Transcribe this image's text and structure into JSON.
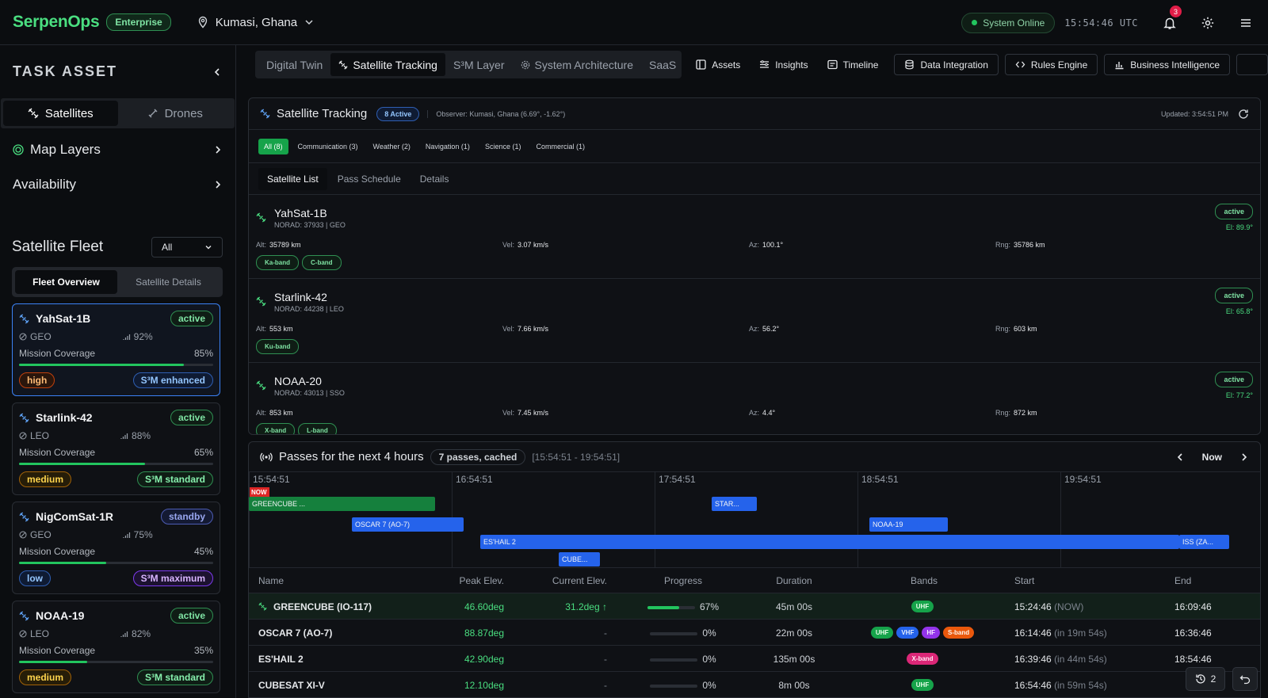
{
  "app": {
    "name": "SerpenOps",
    "tier": "Enterprise",
    "location": "Kumasi, Ghana",
    "status": "System Online",
    "clock": "15:54:46 UTC",
    "notifications": "3"
  },
  "sidebar": {
    "title": "TASK ASSET",
    "tabs": [
      "Satellites",
      "Drones"
    ],
    "sections": [
      "Map Layers",
      "Availability"
    ],
    "fleet_title": "Satellite Fleet",
    "filter_value": "All",
    "fleet_tabs": [
      "Fleet Overview",
      "Satellite Details"
    ],
    "coverage_label": "Mission Coverage",
    "cards": [
      {
        "name": "YahSat-1B",
        "status": "active",
        "orbit": "GEO",
        "signal": "92%",
        "coverage": "85%",
        "coverage_value": 85,
        "priority": "high",
        "s3m": "S³M enhanced"
      },
      {
        "name": "Starlink-42",
        "status": "active",
        "orbit": "LEO",
        "signal": "88%",
        "coverage": "65%",
        "coverage_value": 65,
        "priority": "medium",
        "s3m": "S³M standard"
      },
      {
        "name": "NigComSat-1R",
        "status": "standby",
        "orbit": "GEO",
        "signal": "75%",
        "coverage": "45%",
        "coverage_value": 45,
        "priority": "low",
        "s3m": "S³M maximum"
      },
      {
        "name": "NOAA-19",
        "status": "active",
        "orbit": "LEO",
        "signal": "82%",
        "coverage": "35%",
        "coverage_value": 35,
        "priority": "medium",
        "s3m": "S³M standard"
      }
    ]
  },
  "nav": {
    "tabs": [
      "Digital Twin",
      "Satellite Tracking",
      "S³M Layer",
      "System Architecture",
      "SaaS"
    ],
    "buttons": [
      "Assets",
      "Insights",
      "Timeline"
    ],
    "boxed": [
      "Data Integration",
      "Rules Engine",
      "Business Intelligence"
    ]
  },
  "tracking": {
    "title": "Satellite Tracking",
    "active": "8 Active",
    "observer": "Observer: Kumasi, Ghana (6.69°, -1.62°)",
    "updated": "Updated: 3:54:51 PM",
    "filters": [
      "All (8)",
      "Communication (3)",
      "Weather (2)",
      "Navigation (1)",
      "Science (1)",
      "Commercial (1)"
    ],
    "subtabs": [
      "Satellite List",
      "Pass Schedule",
      "Details"
    ],
    "labels": {
      "alt": "Alt:",
      "vel": "Vel:",
      "az": "Az:",
      "rng": "Rng:"
    },
    "satellites": [
      {
        "name": "YahSat-1B",
        "norad": "NORAD: 37933 | GEO",
        "status": "active",
        "el": "El: 89.9°",
        "alt": "35789 km",
        "vel": "3.07 km/s",
        "az": "100.1°",
        "rng": "35786 km",
        "bands": [
          "Ka-band",
          "C-band"
        ]
      },
      {
        "name": "Starlink-42",
        "norad": "NORAD: 44238 | LEO",
        "status": "active",
        "el": "El: 65.8°",
        "alt": "553 km",
        "vel": "7.66 km/s",
        "az": "56.2°",
        "rng": "603 km",
        "bands": [
          "Ku-band"
        ]
      },
      {
        "name": "NOAA-20",
        "norad": "NORAD: 43013 | SSO",
        "status": "active",
        "el": "El: 77.2°",
        "alt": "853 km",
        "vel": "7.45 km/s",
        "az": "4.4°",
        "rng": "872 km",
        "bands": [
          "X-band",
          "L-band"
        ]
      }
    ]
  },
  "passes": {
    "title": "Passes for the next 4 hours",
    "cached": "7 passes, cached",
    "range": "[15:54:51 - 19:54:51]",
    "now_btn": "Now",
    "now_marker": "NOW",
    "ticks": [
      "15:54:51",
      "16:54:51",
      "17:54:51",
      "18:54:51",
      "19:54:51"
    ],
    "timeline": [
      {
        "label": "GREENCUBE ...",
        "color": "#15803d",
        "start_min": 0,
        "end_min": 45,
        "lane": 0
      },
      {
        "label": "STAR...",
        "color": "#2563eb",
        "start_min": 112,
        "end_min": 123,
        "lane": 0
      },
      {
        "label": "OSCAR 7 (AO-7)",
        "color": "#2563eb",
        "start_min": 25,
        "end_min": 52,
        "lane": 1
      },
      {
        "label": "NOAA-19",
        "color": "#2563eb",
        "start_min": 150,
        "end_min": 169,
        "lane": 1
      },
      {
        "label": "ES'HAIL 2",
        "color": "#2563eb",
        "start_min": 56,
        "end_min": 225,
        "lane": 2
      },
      {
        "label": "ISS (ZA...",
        "color": "#2563eb",
        "start_min": 225,
        "end_min": 237,
        "lane": 2
      },
      {
        "label": "CUBE...",
        "color": "#2563eb",
        "start_min": 75,
        "end_min": 85,
        "lane": 3
      }
    ],
    "columns": [
      "Name",
      "Peak Elev.",
      "Current Elev.",
      "Progress",
      "Duration",
      "Bands",
      "Start",
      "End"
    ],
    "rows": [
      {
        "name": "GREENCUBE (IO-117)",
        "peak": "46.60deg",
        "current": "31.2deg ↑",
        "progress": "67%",
        "progress_value": 67,
        "duration": "45m 00s",
        "bands": [
          "UHF"
        ],
        "start": "15:24:46",
        "start_rel": "(NOW)",
        "end": "16:09:46"
      },
      {
        "name": "OSCAR 7 (AO-7)",
        "peak": "88.87deg",
        "current": "-",
        "progress": "0%",
        "progress_value": 0,
        "duration": "22m 00s",
        "bands": [
          "UHF",
          "VHF",
          "HF",
          "S-band"
        ],
        "start": "16:14:46",
        "start_rel": "(in 19m 54s)",
        "end": "16:36:46"
      },
      {
        "name": "ES'HAIL 2",
        "peak": "42.90deg",
        "current": "-",
        "progress": "0%",
        "progress_value": 0,
        "duration": "135m 00s",
        "bands": [
          "X-band"
        ],
        "start": "16:39:46",
        "start_rel": "(in 44m 54s)",
        "end": "18:54:46"
      },
      {
        "name": "CUBESAT XI-V",
        "peak": "12.10deg",
        "current": "-",
        "progress": "0%",
        "progress_value": 0,
        "duration": "8m 00s",
        "bands": [
          "UHF"
        ],
        "start": "16:54:46",
        "start_rel": "(in 59m 54s)",
        "end": ""
      }
    ],
    "history_count": "2"
  }
}
